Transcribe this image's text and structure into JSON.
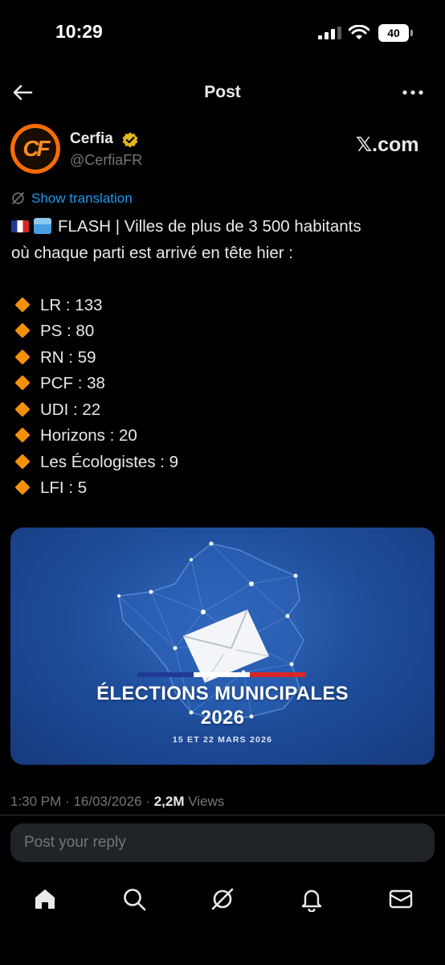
{
  "status_bar": {
    "time": "10:29",
    "battery": "40"
  },
  "header": {
    "title": "Post"
  },
  "author": {
    "name": "Cerfia",
    "handle": "@CerfiaFR",
    "avatar_text": "CF",
    "site_label": "𝕏.com"
  },
  "translation": {
    "label": "Show translation"
  },
  "post": {
    "headline_line1": "FLASH | Villes de plus de 3 500 habitants",
    "headline_line2": "où chaque parti est arrivé en tête hier :",
    "items": [
      {
        "text": "LR : 133"
      },
      {
        "text": "PS : 80"
      },
      {
        "text": "RN : 59"
      },
      {
        "text": "PCF : 38"
      },
      {
        "text": "UDI : 22"
      },
      {
        "text": "Horizons : 20"
      },
      {
        "text": "Les Écologistes : 9"
      },
      {
        "text": "LFI : 5"
      }
    ]
  },
  "media": {
    "title_line1": "ÉLECTIONS MUNICIPALES",
    "title_line2": "2026",
    "date": "15 ET 22 MARS 2026"
  },
  "meta": {
    "time": "1:30 PM",
    "date": "16/03/2026",
    "views_count": "2,2M",
    "views_label": "Views"
  },
  "reply": {
    "placeholder": "Post your reply"
  },
  "nav": [
    "home-icon",
    "search-icon",
    "grok-icon",
    "notifications-icon",
    "messages-icon"
  ],
  "colors": {
    "accent": "#1d9bf0",
    "background": "#000000",
    "bullet": "#f4900c",
    "verified": "#e2b719"
  }
}
